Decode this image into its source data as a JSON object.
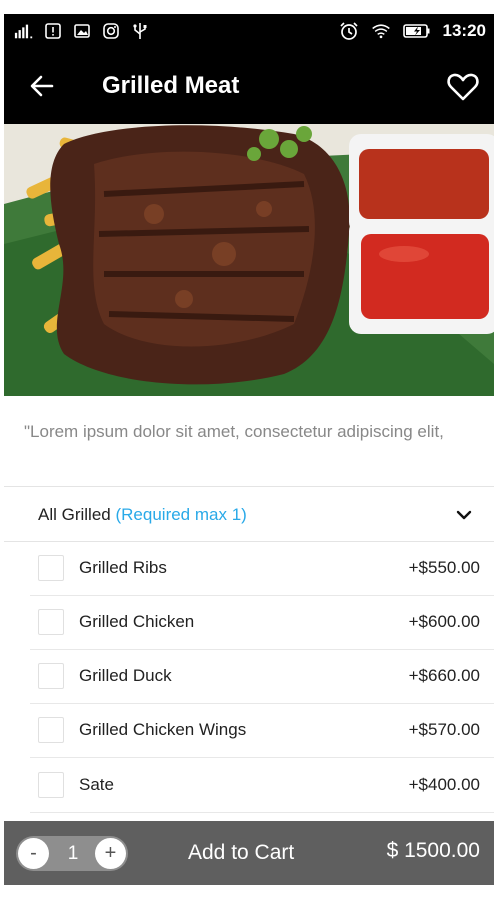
{
  "status_bar": {
    "time": "13:20"
  },
  "header": {
    "title": "Grilled Meat"
  },
  "description": "\"Lorem ipsum dolor sit amet, consectetur adipiscing elit,",
  "group": {
    "title": "All Grilled",
    "requirement": "(Required max 1)"
  },
  "options": [
    {
      "name": "Grilled Ribs",
      "price": "+$550.00"
    },
    {
      "name": "Grilled Chicken",
      "price": "+$600.00"
    },
    {
      "name": "Grilled Duck",
      "price": "+$660.00"
    },
    {
      "name": "Grilled Chicken Wings",
      "price": "+$570.00"
    },
    {
      "name": "Sate",
      "price": "+$400.00"
    }
  ],
  "cart": {
    "minus": "-",
    "quantity": "1",
    "plus": "+",
    "add_label": "Add to Cart",
    "total": "$ 1500.00"
  },
  "colors": {
    "bar": "#000000",
    "accent": "#29a9e8",
    "bottom_bar": "#5f5f5f"
  }
}
